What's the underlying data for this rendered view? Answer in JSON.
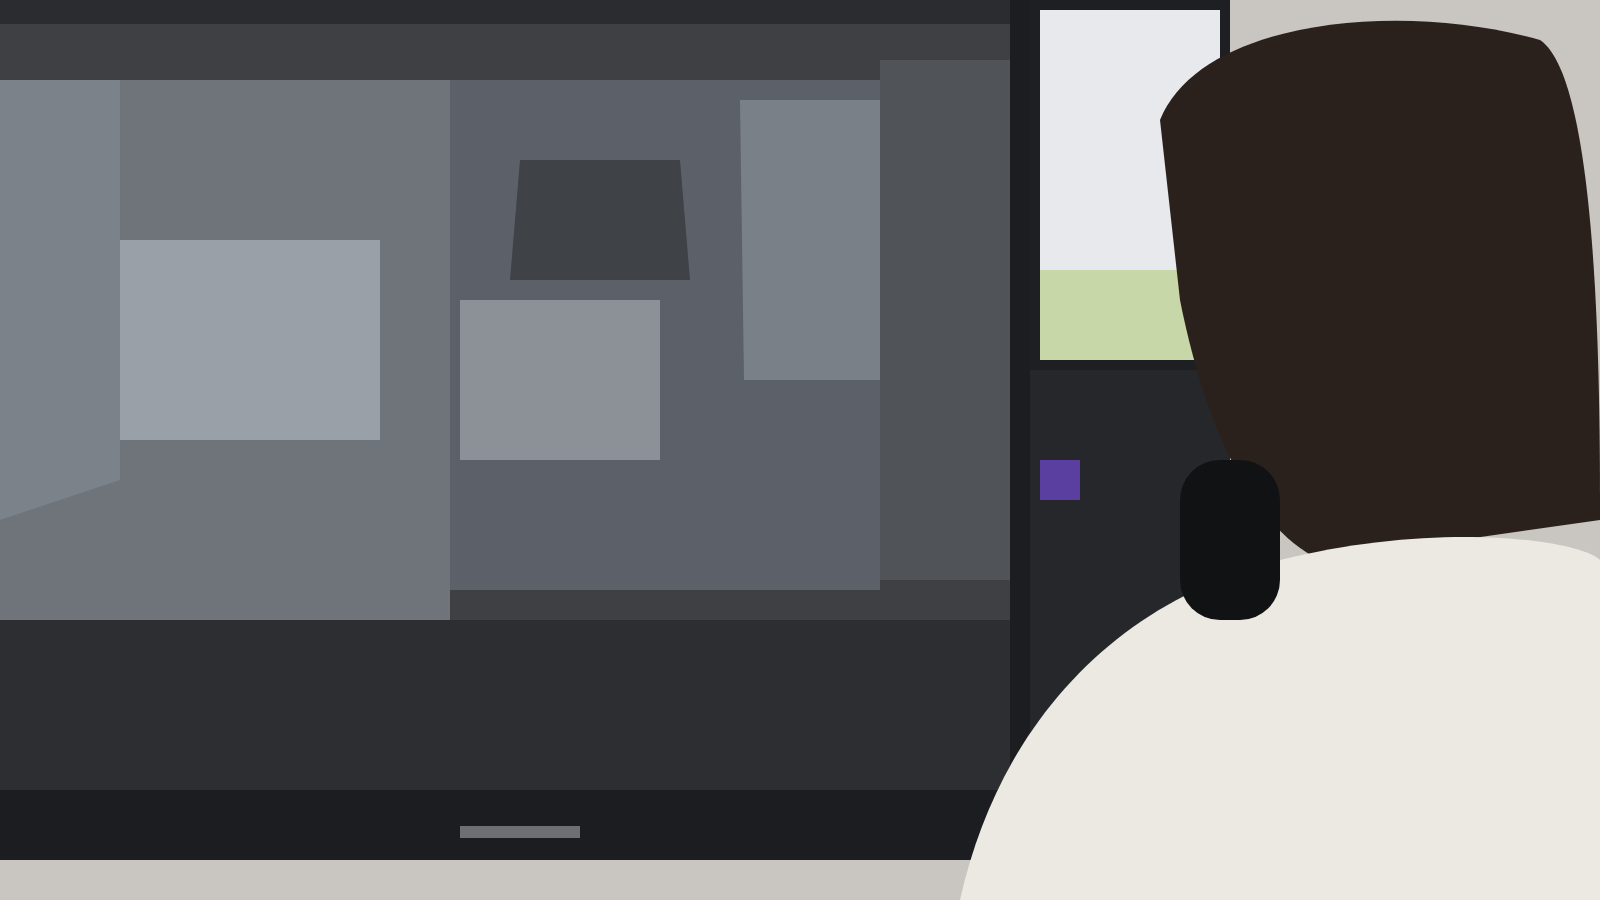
{
  "photo": {
    "kind": "monitor-scene"
  }
}
